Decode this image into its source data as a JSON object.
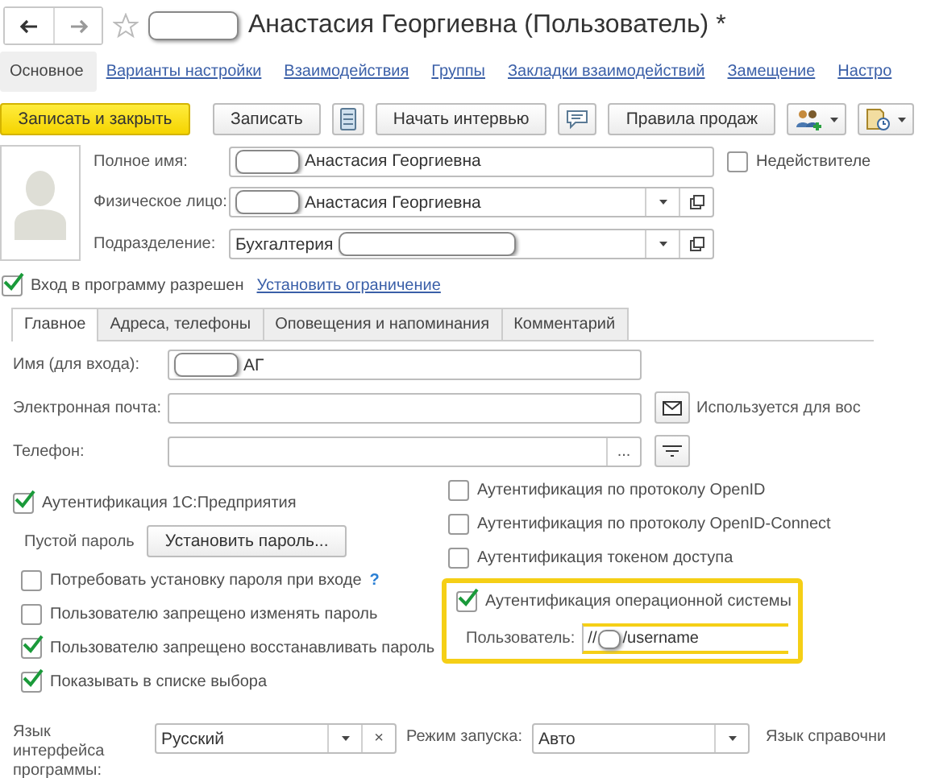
{
  "header": {
    "title": "Анастасия Георгиевна (Пользователь) *"
  },
  "nav_tabs": [
    {
      "label": "Основное",
      "selected": true
    },
    {
      "label": "Варианты настройки",
      "selected": false
    },
    {
      "label": "Взаимодействия",
      "selected": false
    },
    {
      "label": "Группы",
      "selected": false
    },
    {
      "label": "Закладки взаимодействий",
      "selected": false
    },
    {
      "label": "Замещение",
      "selected": false
    },
    {
      "label": "Настро",
      "selected": false
    }
  ],
  "toolbar": {
    "primary": "Записать и закрыть",
    "buttons": [
      {
        "kind": "text",
        "label": "Записать"
      },
      {
        "kind": "list"
      },
      {
        "kind": "text",
        "label": "Начать интервью"
      },
      {
        "kind": "comment"
      },
      {
        "kind": "text",
        "label": "Правила продаж"
      },
      {
        "kind": "users"
      },
      {
        "kind": "report"
      }
    ]
  },
  "main_fields": [
    {
      "label": "Полное имя:",
      "value": "Анастасия Георгиевна",
      "kind": "text",
      "redaction_first": true
    },
    {
      "label": "Физическое лицо:",
      "value": "Анастасия Георгиевна",
      "kind": "choice",
      "redaction_first": true
    },
    {
      "label": "Подразделение:",
      "value": "Бухгалтерия",
      "kind": "choice",
      "redaction_first": false
    }
  ],
  "inactive": {
    "label": "Недействителе",
    "checked": false
  },
  "login_allowed": {
    "label": "Вход в программу разрешен",
    "checked": true,
    "link": "Установить ограничение"
  },
  "inner_tabs": [
    {
      "label": "Главное",
      "selected": true
    },
    {
      "label": "Адреса, телефоны",
      "selected": false
    },
    {
      "label": "Оповещения и напоминания",
      "selected": false
    },
    {
      "label": "Комментарий",
      "selected": false
    }
  ],
  "login_fields": [
    {
      "label": "Имя (для входа):",
      "value": "АГ",
      "kind": "name"
    },
    {
      "label": "Электронная почта:",
      "kind": "email",
      "note": "Используется для вос"
    },
    {
      "label": "Телефон:",
      "kind": "phone",
      "more": "..."
    }
  ],
  "auth_1c": {
    "label": "Аутентификация 1С:Предприятия",
    "checked": true
  },
  "password": {
    "label": "Пустой пароль",
    "button": "Установить пароль..."
  },
  "password_options": [
    {
      "label": "Потребовать установку пароля при входе",
      "checked": false,
      "help": "?"
    },
    {
      "label": "Пользователю запрещено изменять пароль",
      "checked": false
    },
    {
      "label": "Пользователю запрещено восстанавливать пароль",
      "checked": true
    },
    {
      "label": "Показывать в списке выбора",
      "checked": true
    }
  ],
  "auth_other": [
    {
      "label": "Аутентификация по протоколу OpenID",
      "checked": false
    },
    {
      "label": "Аутентификация по протоколу OpenID-Connect",
      "checked": false
    },
    {
      "label": "Аутентификация токеном доступа",
      "checked": false
    }
  ],
  "os_auth": {
    "label": "Аутентификация операционной системы",
    "checked": true,
    "user_label": "Пользователь:",
    "value_prefix": "//",
    "value_suffix": "/username"
  },
  "bottom": {
    "interface_language": {
      "label": "Язык интерфейса программы:",
      "value": "Русский",
      "clear": "×"
    },
    "launch_mode": {
      "label": "Режим запуска:",
      "value": "Авто"
    },
    "help_language": "Язык справочни"
  }
}
